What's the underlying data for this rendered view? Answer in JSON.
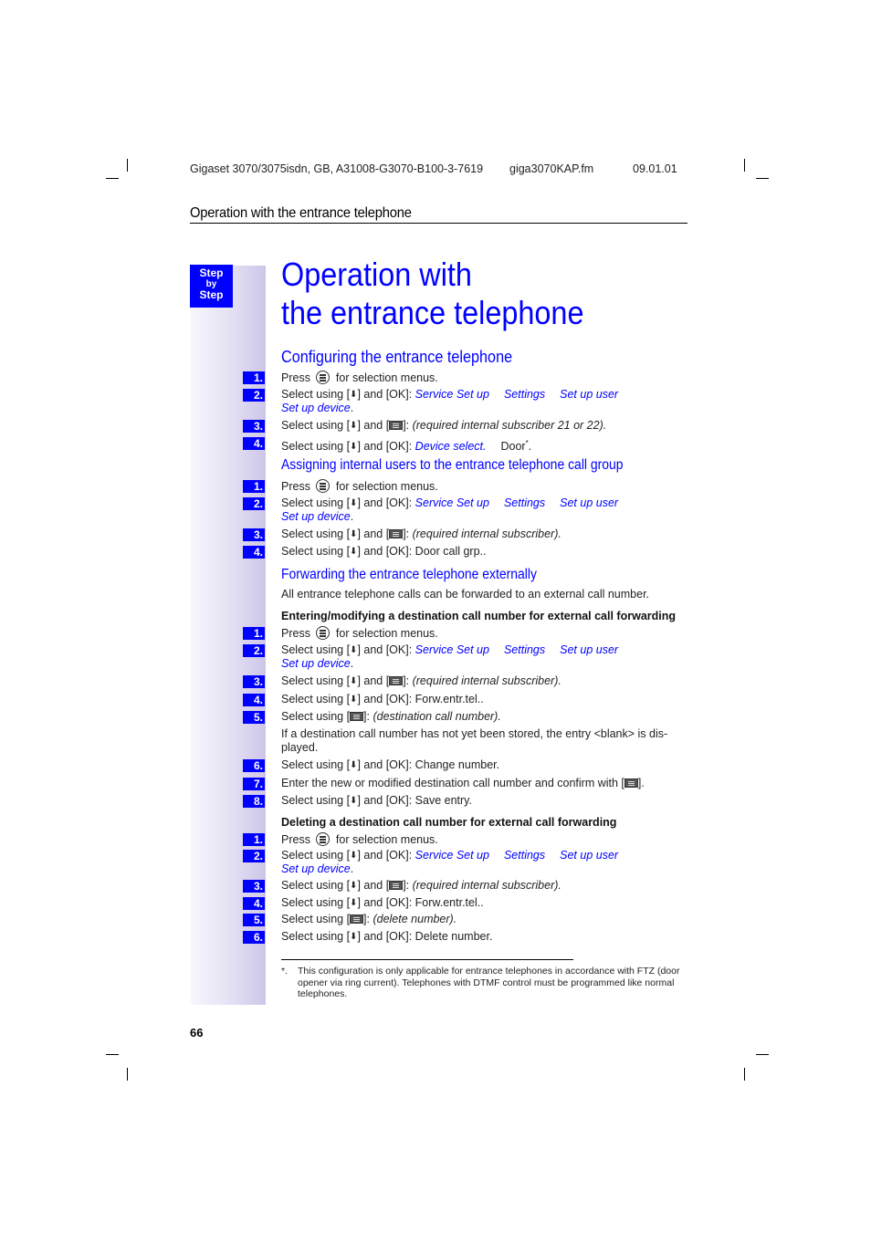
{
  "header": {
    "doc_id": "Gigaset 3070/3075isdn, GB, A31008-G3070-B100-3-7619",
    "file_name": "giga3070KAP.fm",
    "date": "09.01.01",
    "running_head": "Operation with the entrance telephone"
  },
  "sidebar": {
    "badge_line1": "Step",
    "badge_line2": "by",
    "badge_line3": "Step",
    "accent_color": "#0000ff"
  },
  "title": {
    "line1": "Operation with",
    "line2": "the entrance telephone"
  },
  "common": {
    "press": "Press",
    "for_selection_menus": "for selection menus.",
    "select_using_down_ok_pre": "Select using [",
    "select_using_down_ok_post": "] and [OK]: ",
    "select_using_down_key_post": "] and [",
    "close_bracket_colon": "]: ",
    "select_using_key_pre": "Select using [",
    "menu_service": "Service Set up",
    "menu_settings": "Settings",
    "menu_setup_user": "Set up user",
    "menu_setup_device": "Set up device",
    "period": ".",
    "down_arrow": "⬇"
  },
  "section1": {
    "heading": "Configuring the entrance telephone",
    "step3_note": "(required internal subscriber 21 or 22).",
    "step4_menu": "Device select.",
    "step4_value": "Door",
    "step4_footnote_mark": "*",
    "numbers": [
      "1.",
      "2.",
      "3.",
      "4."
    ]
  },
  "section2": {
    "heading": "Assigning internal users to the entrance telephone call group",
    "step3_note": "(required internal subscriber).",
    "step4_value": "Door call grp..",
    "numbers": [
      "1.",
      "2.",
      "3.",
      "4."
    ]
  },
  "section3": {
    "heading": "Forwarding the entrance telephone externally",
    "intro": "All entrance telephone calls can be forwarded to an external call number.",
    "sub1": {
      "heading": "Entering/modifying a destination call number for external call forwarding",
      "step3_note": "(required internal subscriber).",
      "step4_value": "Forw.entr.tel..",
      "step5_note": "(destination call number).",
      "note_after_5": "If a destination call number has not yet been stored, the entry <blank> is dis-played.",
      "step6_value": "Change number.",
      "step7_text": "Enter the new or modified destination call number and confirm with [",
      "step7_end": "].",
      "step8_value": "Save entry.",
      "numbers": [
        "1.",
        "2.",
        "3.",
        "4.",
        "5.",
        "6.",
        "7.",
        "8."
      ]
    },
    "sub2": {
      "heading": "Deleting a destination call number for external call forwarding",
      "step3_note": "(required internal subscriber).",
      "step4_value": "Forw.entr.tel..",
      "step5_note": "(delete number).",
      "step6_value": "Delete number.",
      "numbers": [
        "1.",
        "2.",
        "3.",
        "4.",
        "5.",
        "6."
      ]
    }
  },
  "footnote": {
    "mark": "*.",
    "text": "This configuration is only applicable for entrance telephones in accordance with FTZ (door opener via ring current). Telephones with DTMF control must be programmed like normal telephones."
  },
  "page_number": "66"
}
